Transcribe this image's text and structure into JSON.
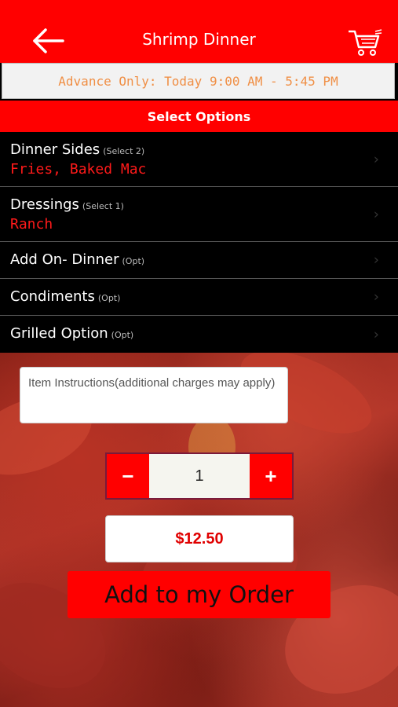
{
  "header": {
    "title": "Shrimp Dinner",
    "back_icon": "back-arrow-icon",
    "cart_icon": "cart-icon",
    "color": "#ff0000"
  },
  "availability": "Advance Only: Today 9:00 AM - 5:45 PM",
  "select_options_label": "Select Options",
  "options": [
    {
      "label": "Dinner Sides",
      "note": "(Select 2)",
      "value": "Fries, Baked Mac"
    },
    {
      "label": "Dressings",
      "note": "(Select 1)",
      "value": "Ranch"
    },
    {
      "label": "Add On- Dinner",
      "note": "(Opt)"
    },
    {
      "label": "Condiments",
      "note": "(Opt)"
    },
    {
      "label": "Grilled Option",
      "note": "(Opt)"
    }
  ],
  "instructions_placeholder": "Item Instructions(additional charges may apply)",
  "quantity": {
    "minus": "−",
    "value": "1",
    "plus": "+"
  },
  "price": "$12.50",
  "add_button": "Add to my Order"
}
